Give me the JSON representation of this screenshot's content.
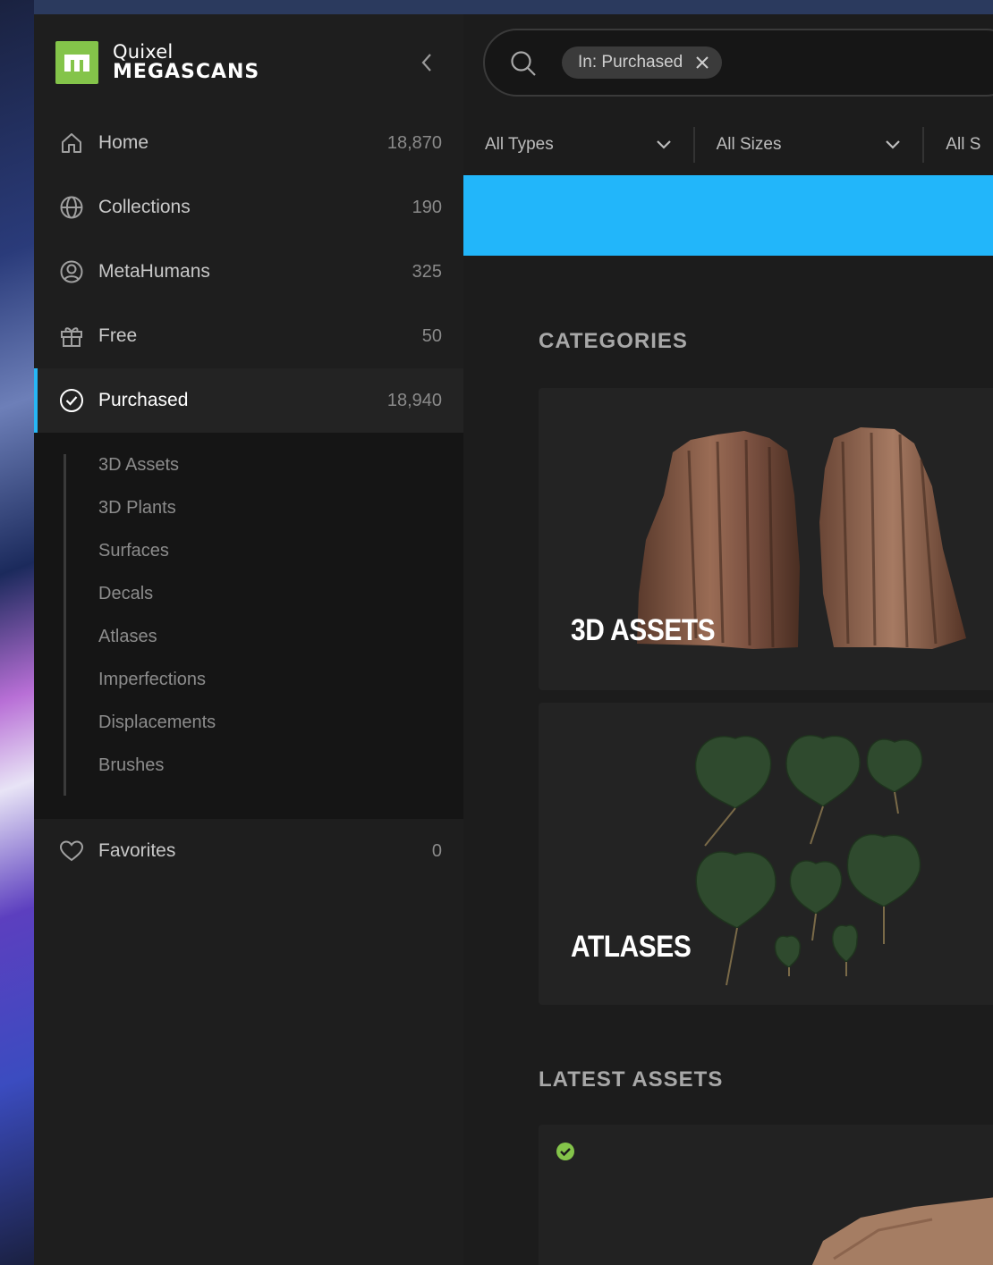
{
  "brand": {
    "name_top": "Quixel",
    "name_bottom": "MEGASCANS",
    "color": "#84c44a"
  },
  "nav": {
    "items": [
      {
        "label": "Home",
        "count": "18,870",
        "icon": "home-icon"
      },
      {
        "label": "Collections",
        "count": "190",
        "icon": "globe-icon"
      },
      {
        "label": "MetaHumans",
        "count": "325",
        "icon": "user-circle-icon"
      },
      {
        "label": "Free",
        "count": "50",
        "icon": "gift-icon"
      },
      {
        "label": "Purchased",
        "count": "18,940",
        "icon": "check-circle-icon",
        "active": true
      }
    ],
    "sub_items": [
      "3D Assets",
      "3D Plants",
      "Surfaces",
      "Decals",
      "Atlases",
      "Imperfections",
      "Displacements",
      "Brushes"
    ],
    "favorites": {
      "label": "Favorites",
      "count": "0",
      "icon": "heart-icon"
    }
  },
  "search": {
    "chip_label": "In: Purchased"
  },
  "filters": {
    "types": "All Types",
    "sizes": "All Sizes",
    "third": "All S"
  },
  "colors": {
    "accent": "#27b6f5",
    "banner": "#22b6fa"
  },
  "sections": {
    "categories_title": "CATEGORIES",
    "latest_title": "LATEST ASSETS"
  },
  "categories": [
    {
      "label": "3D ASSETS"
    },
    {
      "label": "ATLASES"
    }
  ]
}
